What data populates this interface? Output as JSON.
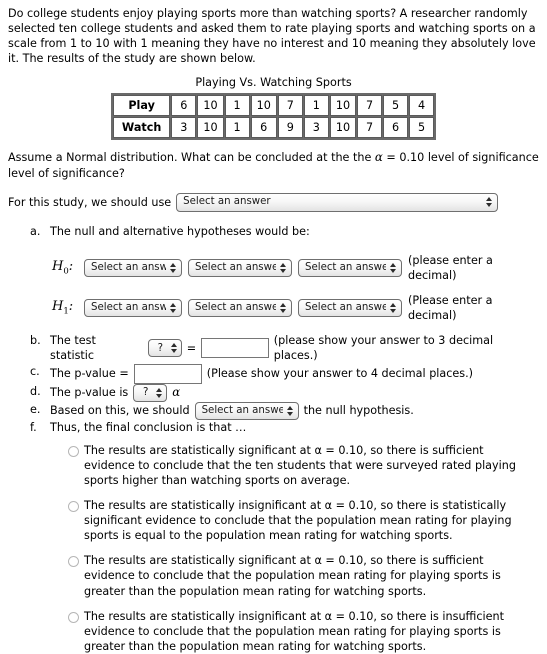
{
  "intro": {
    "paragraph": "Do college students enjoy playing sports more than watching sports? A researcher randomly selected ten college students and asked them to rate playing sports and watching sports on a scale from 1 to 10 with 1 meaning they have no interest and 10 meaning they absolutely love it. The results of the study are shown below."
  },
  "table": {
    "title": "Playing Vs. Watching Sports",
    "rows": [
      {
        "label": "Play",
        "values": [
          "6",
          "10",
          "1",
          "10",
          "7",
          "1",
          "10",
          "7",
          "5",
          "4"
        ]
      },
      {
        "label": "Watch",
        "values": [
          "3",
          "10",
          "1",
          "6",
          "9",
          "3",
          "10",
          "7",
          "6",
          "5"
        ]
      }
    ]
  },
  "assume": {
    "text_before_alpha": "Assume a Normal distribution.  What can be concluded at the the ",
    "alpha": "α",
    "text_after_alpha": " = 0.10 level of significance level of significance?"
  },
  "study_use": {
    "label": "For this study, we should use",
    "select_value": "Select an answer"
  },
  "items": {
    "a": {
      "text": "The null and alternative hypotheses would be:"
    },
    "b": {
      "text": "The test statistic",
      "select_value": "?",
      "equals": "=",
      "input_value": "",
      "note": "(please show your answer to 3 decimal places.)"
    },
    "c": {
      "text": "The p-value =",
      "input_value": "",
      "note": "(Please show your answer to 4 decimal places.)"
    },
    "d": {
      "text": "The p-value is",
      "select_value": "?",
      "alpha": "α"
    },
    "e": {
      "text_before": "Based on this, we should",
      "select_value": "Select an answer",
      "text_after": "the null hypothesis."
    },
    "f": {
      "text": "Thus, the final conclusion is that …"
    }
  },
  "hypotheses": [
    {
      "label_base": "H",
      "label_sub": "0",
      "colon": ":",
      "select1": "Select an answer",
      "select2": "Select an answer",
      "select3": "Select an answer",
      "note": "(please enter a decimal)"
    },
    {
      "label_base": "H",
      "label_sub": "1",
      "colon": ":",
      "select1": "Select an answer",
      "select2": "Select an answer",
      "select3": "Select an answer",
      "note": "(Please enter a decimal)"
    }
  ],
  "conclusions": [
    {
      "text": "The results are statistically significant at α = 0.10, so there is sufficient evidence to conclude that the ten students that were surveyed rated playing sports higher than watching sports on average.",
      "selected": false
    },
    {
      "text": "The results are statistically insignificant at α = 0.10, so there is statistically significant evidence to conclude that the population mean rating for playing sports is equal to the population mean rating for watching sports.",
      "selected": false
    },
    {
      "text": "The results are statistically significant at α = 0.10, so there is sufficient evidence to conclude that the population mean rating for playing sports is greater than the population mean rating for watching sports.",
      "selected": false
    },
    {
      "text": "The results are statistically insignificant at α = 0.10, so there is insufficient evidence to conclude that the population mean rating for playing sports is greater than the population mean rating for watching sports.",
      "selected": false
    }
  ]
}
